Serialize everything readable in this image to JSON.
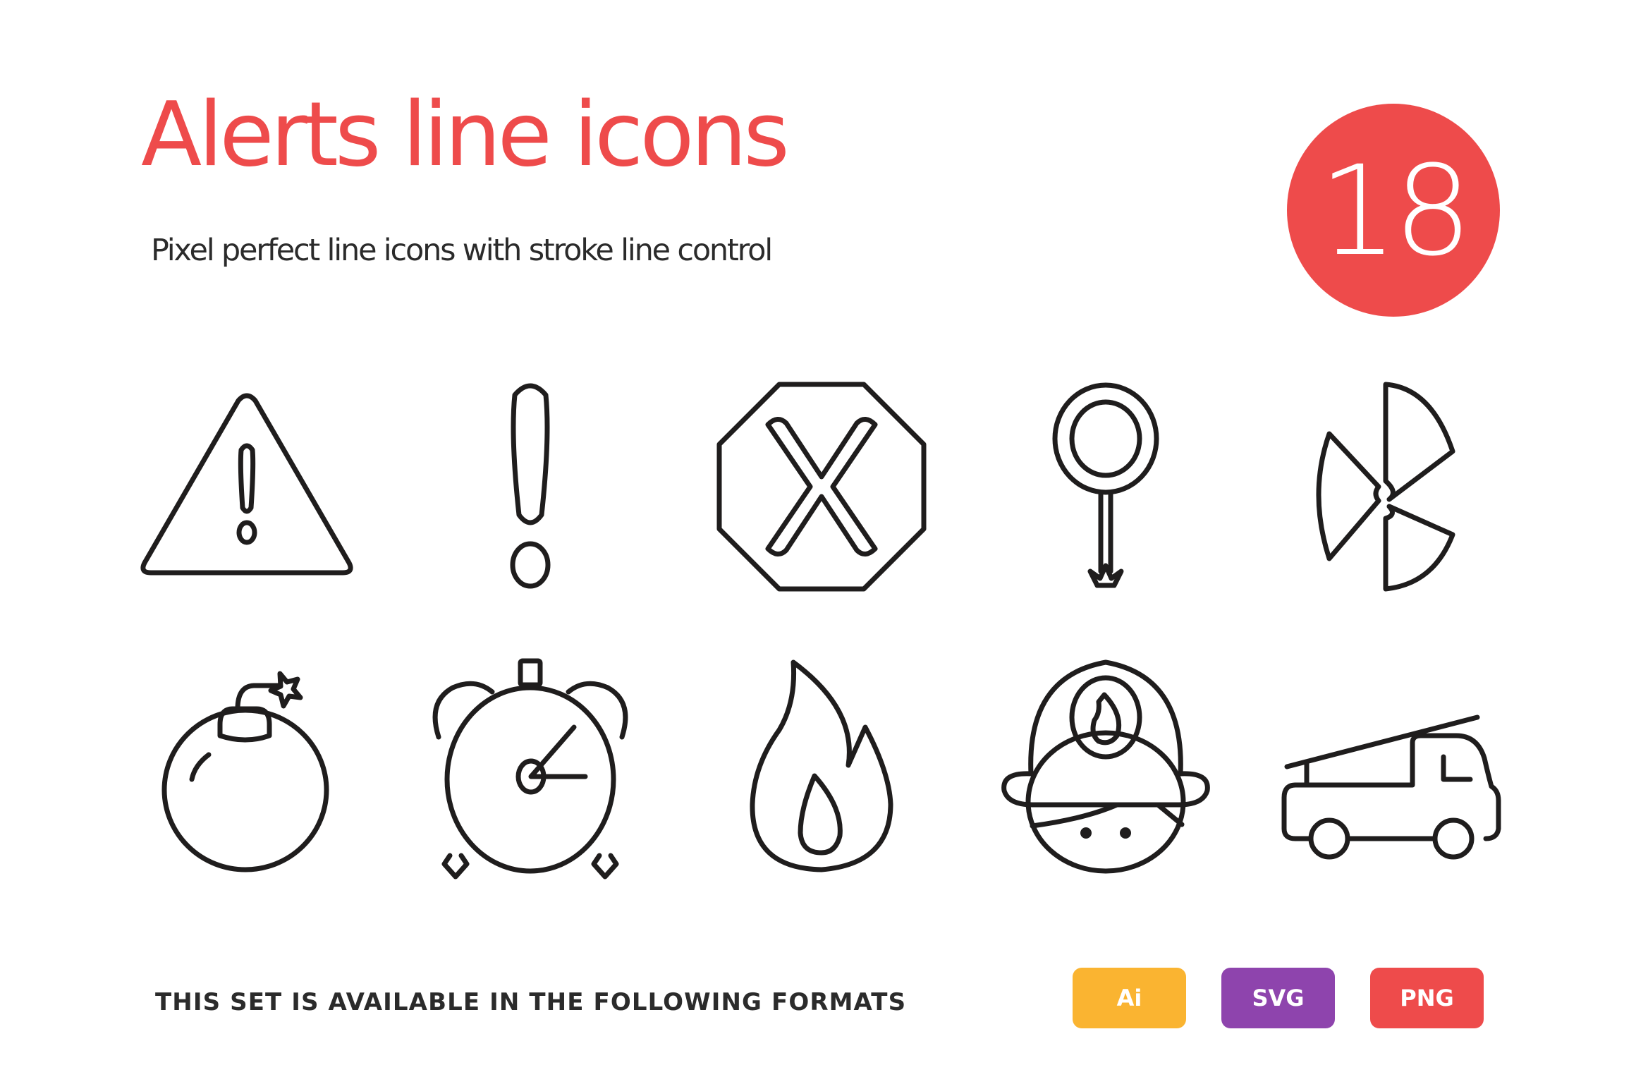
{
  "header": {
    "title": "Alerts line icons",
    "subtitle": "Pixel perfect line icons with stroke line control",
    "icon_count": "18"
  },
  "colors": {
    "accent": "#ee4b4b",
    "text_dark": "#2b2b2b",
    "icon_stroke": "#1f1d1d",
    "ai_badge": "#fab431",
    "svg_badge": "#8e44ad",
    "png_badge": "#ee4b4b"
  },
  "icons": [
    {
      "name": "warning-triangle"
    },
    {
      "name": "exclamation-mark"
    },
    {
      "name": "stop-octagon-x"
    },
    {
      "name": "signal-paddle-sign"
    },
    {
      "name": "radiation"
    },
    {
      "name": "bomb"
    },
    {
      "name": "alarm-clock"
    },
    {
      "name": "fire-flame"
    },
    {
      "name": "firefighter"
    },
    {
      "name": "fire-truck"
    }
  ],
  "footer": {
    "caption": "THIS SET IS AVAILABLE IN THE FOLLOWING FORMATS",
    "formats": [
      {
        "label": "Ai"
      },
      {
        "label": "SVG"
      },
      {
        "label": "PNG"
      }
    ]
  }
}
